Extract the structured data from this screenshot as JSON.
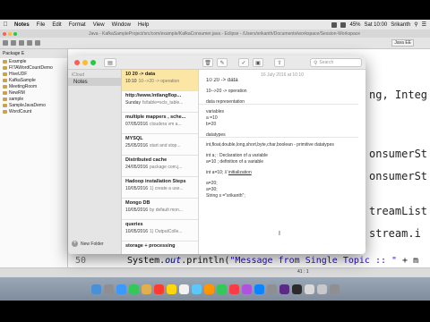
{
  "menubar": {
    "app_name": "Notes",
    "menus": [
      "File",
      "Edit",
      "Format",
      "View",
      "Window",
      "Help"
    ],
    "battery": "45%",
    "clock": "Sat 10:00",
    "user": "Srikanth"
  },
  "eclipse": {
    "title": "Java - KafkaSampleProject/src/com/example/KafkaConsumer.java - Eclipse - /Users/srikanth/Documents/workspace/Session-Workspace",
    "perspective": "Java EE",
    "package_explorer_title": "Package E",
    "projects": [
      "Example",
      "FITAWordCountDemo",
      "HiveUDF",
      "KafkaSample",
      "MeetingRoom",
      "NewRM",
      "sample",
      "SampleJavaDemo",
      "WordCount"
    ],
    "code_right": [
      "ng, Integ",
      "onsumerSt",
      "onsumerSt",
      "treamList",
      "stream.i",
      ""
    ],
    "bottom_line_no": "50",
    "bottom_code_prefix": "System.",
    "bottom_code_out": "out",
    "bottom_code_call": ".println(",
    "bottom_code_string": "\"Message from Single Topic :: \"",
    "bottom_code_suffix": "+ m",
    "status_position": "41 : 1"
  },
  "notes_window": {
    "search_placeholder": "Search",
    "account_label": "iCloud",
    "selected_folder": "Notes",
    "new_folder_label": "New Folder",
    "notes": [
      {
        "title": "10    20    -> data",
        "date": "10:10",
        "preview": "10-->20 -> operation",
        "selected": true
      },
      {
        "title": "http://www.lntlangflop...",
        "date": "Sunday",
        "preview": "fs/table=scls_table...",
        "selected": false
      },
      {
        "title": "multiple mappers , sche...",
        "date": "07/05/2016",
        "preview": "cloudera vm a...",
        "selected": false
      },
      {
        "title": "MYSQL",
        "date": "25/05/2016",
        "preview": "start and stop...",
        "selected": false
      },
      {
        "title": "Distributed cache",
        "date": "24/05/2016",
        "preview": "package com.j...",
        "selected": false
      },
      {
        "title": "Hadoop installation Steps",
        "date": "10/05/2016",
        "preview": "1) create a use...",
        "selected": false
      },
      {
        "title": "Mongo DB",
        "date": "10/05/2016",
        "preview": "by default mon...",
        "selected": false
      },
      {
        "title": "queries",
        "date": "10/05/2016",
        "preview": "1) OutputColle...",
        "selected": false
      },
      {
        "title": "storage + processing",
        "date": "",
        "preview": "",
        "selected": false
      }
    ],
    "content": {
      "date": "16 July 2016 at 10:10",
      "lines": [
        "10     20    -> data",
        "10-->20  -> operation",
        "data representation",
        "variables",
        "a =10",
        "b=20",
        "datatypes",
        "int,float,double,long,short,byte,char,boolean - primitive datatypes",
        "int a; : Declaration of a variable",
        "a=10 ; definition of a variable",
        "int a=10; // ",
        "a=20;",
        "a=30;",
        "String s =\"srikanth\";"
      ],
      "initialization_word": "initialization"
    }
  },
  "colors": {
    "selected_note": "#fbe6a6",
    "close": "#fc5f57",
    "minimize": "#fdbc2e",
    "zoom": "#28c840"
  }
}
